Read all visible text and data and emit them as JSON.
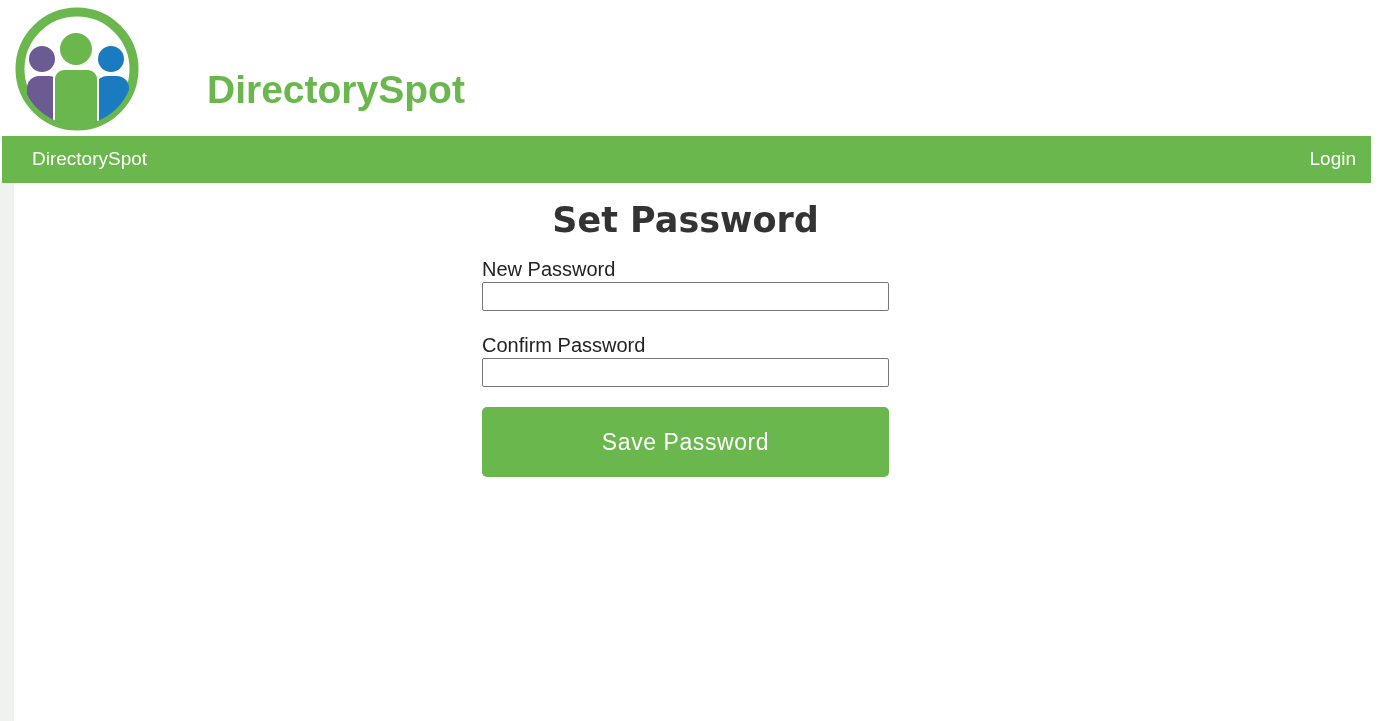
{
  "header": {
    "brand": "DirectorySpot"
  },
  "navbar": {
    "brand": "DirectorySpot",
    "link": "Login"
  },
  "form": {
    "title": "Set Password",
    "fields": [
      {
        "label": "New Password"
      },
      {
        "label": "Confirm Password"
      }
    ],
    "button": "Save Password"
  }
}
